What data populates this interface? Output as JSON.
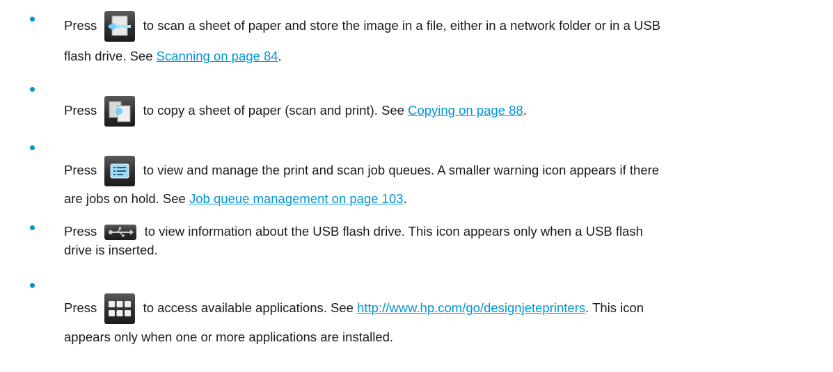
{
  "colors": {
    "accent": "#0096d6",
    "text": "#1a1a1a"
  },
  "items": [
    {
      "icon": "scan-icon",
      "press": "Press",
      "text1": "to scan a sheet of paper and store the image in a file, either in a network folder or in a USB",
      "text2a": "flash drive. See",
      "link": "Scanning on page 84",
      "text2b": "."
    },
    {
      "icon": "copy-icon",
      "press": "Press",
      "text1a": "to copy a sheet of paper (scan and print). See",
      "link": "Copying on page 88",
      "text1b": "."
    },
    {
      "icon": "job-queue-icon",
      "press": "Press",
      "text1": "to view and manage the print and scan job queues. A smaller warning icon appears if there",
      "text2a": "are jobs on hold. See",
      "link": "Job queue management on page 103",
      "text2b": "."
    },
    {
      "icon": "usb-icon",
      "press": "Press",
      "text1": "to view information about the USB flash drive. This icon appears only when a USB flash",
      "text2": "drive is inserted."
    },
    {
      "icon": "applications-icon",
      "press": "Press",
      "text1a": "to access available applications. See",
      "link": "http://www.hp.com/go/designjeteprinters",
      "text1b": ". This icon",
      "text2": "appears only when one or more applications are installed."
    }
  ]
}
